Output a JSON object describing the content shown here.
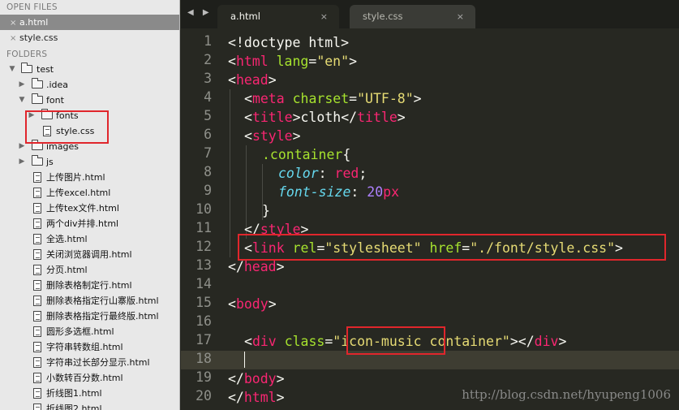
{
  "sidebar": {
    "open_files_header": "OPEN FILES",
    "open_files": [
      {
        "name": "a.html",
        "close": "×"
      },
      {
        "name": "style.css",
        "close": "×"
      }
    ],
    "folders_header": "FOLDERS",
    "tree": [
      {
        "label": "test"
      },
      {
        "label": ".idea"
      },
      {
        "label": "font"
      },
      {
        "label": "fonts"
      },
      {
        "label": "style.css"
      },
      {
        "label": "images"
      },
      {
        "label": "js"
      },
      {
        "label": "上传图片.html"
      },
      {
        "label": "上传excel.html"
      },
      {
        "label": "上传tex文件.html"
      },
      {
        "label": "两个div并排.html"
      },
      {
        "label": "全选.html"
      },
      {
        "label": "关闭浏览器调用.html"
      },
      {
        "label": "分页.html"
      },
      {
        "label": "删除表格制定行.html"
      },
      {
        "label": "删除表格指定行山寨版.html"
      },
      {
        "label": "删除表格指定行最终版.html"
      },
      {
        "label": "圆形多选框.html"
      },
      {
        "label": "字符串转数组.html"
      },
      {
        "label": "字符串过长部分显示.html"
      },
      {
        "label": "小数转百分数.html"
      },
      {
        "label": "折线图1.html"
      },
      {
        "label": "折线图2.html"
      }
    ]
  },
  "tabs": {
    "nav": "◀ ▶",
    "items": [
      {
        "label": "a.html",
        "close": "×"
      },
      {
        "label": "style.css",
        "close": "×"
      }
    ]
  },
  "editor": {
    "line_numbers": [
      "1",
      "2",
      "3",
      "4",
      "5",
      "6",
      "7",
      "8",
      "9",
      "10",
      "11",
      "12",
      "13",
      "14",
      "15",
      "16",
      "17",
      "18",
      "19",
      "20"
    ],
    "code": {
      "l1": {
        "a": "<!doctype html>"
      },
      "l2": {
        "a": "<",
        "b": "html",
        "c": " ",
        "d": "lang",
        "e": "=",
        "f": "\"en\"",
        "g": ">"
      },
      "l3": {
        "a": "<",
        "b": "head",
        "c": ">"
      },
      "l4": {
        "a": "<",
        "b": "meta",
        "c": " ",
        "d": "charset",
        "e": "=",
        "f": "\"UTF-8\"",
        "g": ">"
      },
      "l5": {
        "a": "<",
        "b": "title",
        "c": ">cloth</",
        "d": "title",
        "e": ">"
      },
      "l6": {
        "a": "<",
        "b": "style",
        "c": ">"
      },
      "l7": {
        "a": ".container",
        "b": "{"
      },
      "l8": {
        "a": "color",
        "b": ": ",
        "c": "red",
        "d": ";"
      },
      "l9": {
        "a": "font-size",
        "b": ": ",
        "c": "20",
        "d": "px"
      },
      "l10": {
        "a": "}"
      },
      "l11": {
        "a": "</",
        "b": "style",
        "c": ">"
      },
      "l12": {
        "a": "<",
        "b": "link",
        "c": " ",
        "d": "rel",
        "e": "=",
        "f": "\"stylesheet\"",
        "g": " ",
        "h": "href",
        "i": "=",
        "j": "\"./font/style.css\"",
        "k": ">"
      },
      "l13": {
        "a": "</",
        "b": "head",
        "c": ">"
      },
      "l15": {
        "a": "<",
        "b": "body",
        "c": ">"
      },
      "l17": {
        "a": "<",
        "b": "div",
        "c": " ",
        "d": "class",
        "e": "=",
        "f": "\"",
        "g": "icon-music",
        "h": " container\"",
        "i": "></",
        "j": "div",
        "k": ">"
      },
      "l19": {
        "a": "</",
        "b": "body",
        "c": ">"
      },
      "l20": {
        "a": "</",
        "b": "html",
        "c": ">"
      }
    },
    "current_line": "18",
    "watermark": "http://blog.csdn.net/hyupeng1006"
  },
  "colors": {
    "tag": "#f92672",
    "attr": "#a6e22e",
    "string": "#e6db74",
    "property": "#66d9ef",
    "number": "#ae81ff",
    "highlight_box": "#e0262c"
  }
}
